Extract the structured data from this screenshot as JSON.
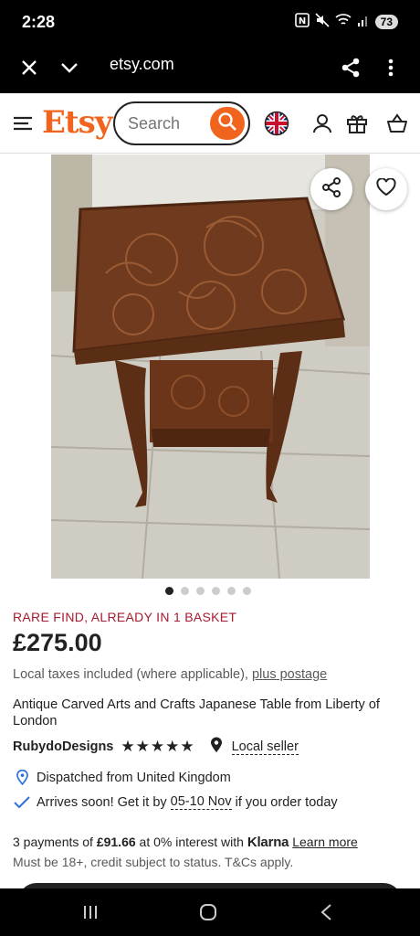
{
  "status_bar": {
    "time": "2:28",
    "battery": "73",
    "icons": [
      "nfc-icon",
      "mute-icon",
      "wifi-icon",
      "signal-icon",
      "battery-icon"
    ]
  },
  "browser": {
    "url": "etsy.com",
    "icons": [
      "close-icon",
      "chevron-down-icon",
      "share-icon",
      "more-vertical-icon"
    ]
  },
  "header": {
    "logo": "Etsy",
    "search_placeholder": "Search",
    "icons": [
      "menu-icon",
      "search-icon",
      "uk-flag-icon",
      "account-icon",
      "gift-icon",
      "basket-icon"
    ],
    "accent_color": "#f1641e"
  },
  "gallery": {
    "total_images": 6,
    "active_index": 0,
    "icons": [
      "share-icon",
      "heart-icon"
    ]
  },
  "listing": {
    "badge": "RARE FIND, ALREADY IN 1 BASKET",
    "badge_color": "#a61a2e",
    "price": "£275.00",
    "tax_text": "Local taxes included (where applicable),",
    "postage_link": "plus postage",
    "title": "Antique Carved Arts and Crafts Japanese Table from Liberty of London",
    "seller": "RubydoDesigns",
    "rating_stars": 5,
    "stars_text": "★★★★★",
    "local_seller": "Local seller",
    "dispatched": "Dispatched from United Kingdom",
    "arrives_pre": "Arrives soon! Get it by",
    "arrives_date": "05-10 Nov",
    "arrives_post": "if you order today"
  },
  "klarna": {
    "pre": "3 payments of",
    "amount": "£91.66",
    "mid": "at 0% interest with",
    "brand": "Klarna",
    "link": "Learn more",
    "fine": "Must be 18+, credit subject to status. T&Cs apply."
  },
  "nav": {
    "icons": [
      "recents-icon",
      "home-icon",
      "back-icon"
    ]
  }
}
